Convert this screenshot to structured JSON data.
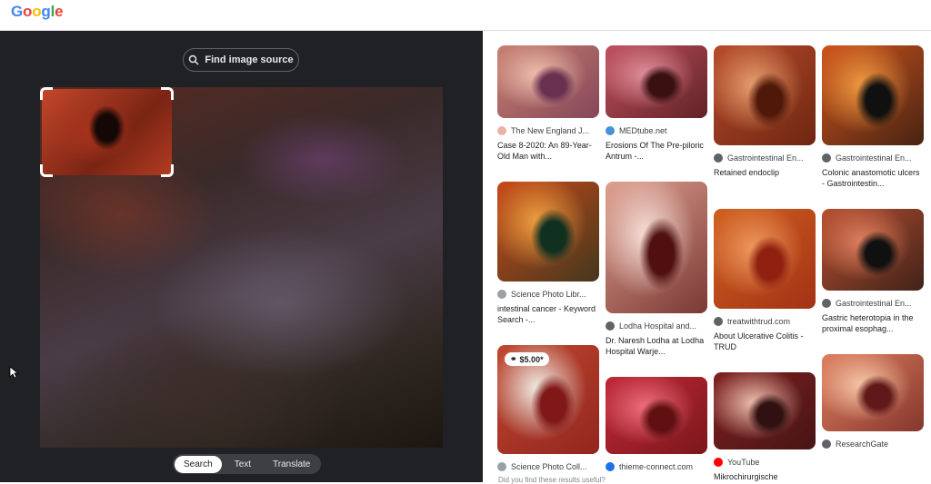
{
  "header": {
    "logo_letters": [
      "G",
      "o",
      "o",
      "g",
      "l",
      "e"
    ],
    "logo_colors": [
      "#4285f4",
      "#ea4335",
      "#fbbc05",
      "#4285f4",
      "#34a853",
      "#ea4335"
    ]
  },
  "lens": {
    "find_source_label": "Find image source",
    "modes": [
      {
        "label": "Search",
        "active": true
      },
      {
        "label": "Text",
        "active": false
      },
      {
        "label": "Translate",
        "active": false
      }
    ]
  },
  "results": [
    {
      "source": "The New England J...",
      "title": "Case 8-2020: An 89-Year-Old Man with...",
      "icon_color": "#e8b4a8",
      "thumb_height": 80,
      "colors": [
        "#c88070",
        "#f0c0b0",
        "#6a3050"
      ],
      "price": ""
    },
    {
      "source": "MEDtube.net",
      "title": "Erosions Of The Pre-piloric Antrum -...",
      "icon_color": "#4a90d9",
      "thumb_height": 80,
      "colors": [
        "#c05060",
        "#e0909a",
        "#3a1010"
      ],
      "price": ""
    },
    {
      "source": "Gastrointestinal En...",
      "title": "Retained endoclip",
      "icon_color": "#5f6368",
      "thumb_height": 110,
      "colors": [
        "#b84a2a",
        "#e8a070",
        "#501808"
      ],
      "price": ""
    },
    {
      "source": "Gastrointestinal En...",
      "title": "Colonic anastomotic ulcers - Gastrointestin...",
      "icon_color": "#5f6368",
      "thumb_height": 110,
      "colors": [
        "#d0541c",
        "#f09a40",
        "#101010"
      ],
      "price": ""
    },
    {
      "source": "Science Photo Libr...",
      "title": "intestinal cancer - Keyword Search -...",
      "icon_color": "#9aa0a6",
      "thumb_height": 110,
      "colors": [
        "#c84a18",
        "#f0a040",
        "#103020"
      ],
      "price": ""
    },
    {
      "source": "Lodha Hospital and...",
      "title": "Dr. Naresh Lodha at Lodha Hospital Warje...",
      "icon_color": "#5f6368",
      "thumb_height": 145,
      "colors": [
        "#e0a090",
        "#f8e0d8",
        "#501010"
      ],
      "price": ""
    },
    {
      "source": "treatwithtrud.com",
      "title": "About Ulcerative Colitis - TRUD",
      "icon_color": "#5f6368",
      "thumb_height": 110,
      "colors": [
        "#d06020",
        "#f09a60",
        "#902010"
      ],
      "price": ""
    },
    {
      "source": "Gastrointestinal En...",
      "title": "Gastric heterotopia in the proximal esophag...",
      "icon_color": "#5f6368",
      "thumb_height": 90,
      "colors": [
        "#b85030",
        "#e08060",
        "#101010"
      ],
      "price": ""
    },
    {
      "source": "Science Photo Coll...",
      "title": "",
      "icon_color": "#9aa0a6",
      "thumb_height": 120,
      "colors": [
        "#c04830",
        "#f0f0e8",
        "#801818"
      ],
      "price": "$5.00*"
    },
    {
      "source": "thieme-connect.com",
      "title": "",
      "icon_color": "#1a73e8",
      "thumb_height": 85,
      "colors": [
        "#c02838",
        "#f07080",
        "#601010"
      ],
      "price": ""
    },
    {
      "source": "YouTube",
      "title": "Mikrochirurgische Operation",
      "icon_color": "#ff0000",
      "thumb_height": 85,
      "colors": [
        "#802020",
        "#f0c0b0",
        "#301010"
      ],
      "price": ""
    },
    {
      "source": "ResearchGate",
      "title": "",
      "icon_color": "#5f6368",
      "thumb_height": 85,
      "colors": [
        "#e08060",
        "#f8c8a8",
        "#601818"
      ],
      "price": ""
    }
  ],
  "footer_hint": "Did you find these results useful?"
}
